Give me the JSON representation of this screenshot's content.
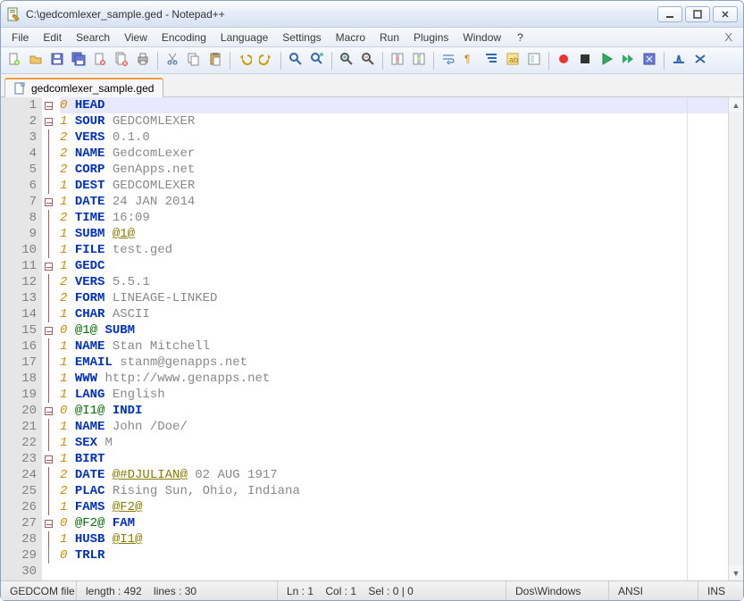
{
  "window": {
    "title": "C:\\gedcomlexer_sample.ged - Notepad++"
  },
  "menu": {
    "items": [
      "File",
      "Edit",
      "Search",
      "View",
      "Encoding",
      "Language",
      "Settings",
      "Macro",
      "Run",
      "Plugins",
      "Window",
      "?"
    ]
  },
  "toolbar": {
    "icons": [
      "new-file",
      "open-file",
      "save",
      "save-all",
      "close",
      "close-all",
      "print",
      "sep",
      "cut",
      "copy",
      "paste",
      "sep",
      "undo",
      "redo",
      "sep",
      "find",
      "replace",
      "sep",
      "zoom-in",
      "zoom-out",
      "sep",
      "sync-v",
      "sync-h",
      "sep",
      "wrap",
      "all-chars",
      "indent-guide",
      "lang",
      "doc-map",
      "sep",
      "record",
      "stop",
      "play",
      "play-multi",
      "save-macro",
      "sep",
      "toggle-1",
      "toggle-2"
    ]
  },
  "tab": {
    "label": "gedcomlexer_sample.ged"
  },
  "code": {
    "lines": [
      {
        "n": 1,
        "fold": "box",
        "lvl": "0",
        "tag": "HEAD",
        "val": "",
        "current": true
      },
      {
        "n": 2,
        "fold": "box",
        "lvl": "1",
        "tag": "SOUR",
        "val": "GEDCOMLEXER"
      },
      {
        "n": 3,
        "fold": "line",
        "lvl": "2",
        "tag": "VERS",
        "val": "0.1.0"
      },
      {
        "n": 4,
        "fold": "line",
        "lvl": "2",
        "tag": "NAME",
        "val": "GedcomLexer"
      },
      {
        "n": 5,
        "fold": "line",
        "lvl": "2",
        "tag": "CORP",
        "val": "GenApps.net"
      },
      {
        "n": 6,
        "fold": "line",
        "lvl": "1",
        "tag": "DEST",
        "val": "GEDCOMLEXER"
      },
      {
        "n": 7,
        "fold": "box",
        "lvl": "1",
        "tag": "DATE",
        "val": "24 JAN 2014"
      },
      {
        "n": 8,
        "fold": "line",
        "lvl": "2",
        "tag": "TIME",
        "val": "16:09"
      },
      {
        "n": 9,
        "fold": "line",
        "lvl": "1",
        "tag": "SUBM",
        "ref": "@1@"
      },
      {
        "n": 10,
        "fold": "line",
        "lvl": "1",
        "tag": "FILE",
        "val": "test.ged"
      },
      {
        "n": 11,
        "fold": "box",
        "lvl": "1",
        "tag": "GEDC",
        "val": ""
      },
      {
        "n": 12,
        "fold": "line",
        "lvl": "2",
        "tag": "VERS",
        "val": "5.5.1"
      },
      {
        "n": 13,
        "fold": "line",
        "lvl": "2",
        "tag": "FORM",
        "val": "LINEAGE-LINKED"
      },
      {
        "n": 14,
        "fold": "line",
        "lvl": "1",
        "tag": "CHAR",
        "val": "ASCII"
      },
      {
        "n": 15,
        "fold": "box",
        "lvl": "0",
        "id": "@1@",
        "tag": "SUBM",
        "val": ""
      },
      {
        "n": 16,
        "fold": "line",
        "lvl": "1",
        "tag": "NAME",
        "val": "Stan Mitchell"
      },
      {
        "n": 17,
        "fold": "line",
        "lvl": "1",
        "tag": "EMAIL",
        "val": "stanm@genapps.net"
      },
      {
        "n": 18,
        "fold": "line",
        "lvl": "1",
        "tag": "WWW",
        "val": "http://www.genapps.net"
      },
      {
        "n": 19,
        "fold": "line",
        "lvl": "1",
        "tag": "LANG",
        "val": "English"
      },
      {
        "n": 20,
        "fold": "box",
        "lvl": "0",
        "id": "@I1@",
        "tag": "INDI",
        "val": ""
      },
      {
        "n": 21,
        "fold": "line",
        "lvl": "1",
        "tag": "NAME",
        "val": "John /Doe/"
      },
      {
        "n": 22,
        "fold": "line",
        "lvl": "1",
        "tag": "SEX",
        "val": "M"
      },
      {
        "n": 23,
        "fold": "box",
        "lvl": "1",
        "tag": "BIRT",
        "val": ""
      },
      {
        "n": 24,
        "fold": "line",
        "lvl": "2",
        "tag": "DATE",
        "ref": "@#DJULIAN@",
        "val": "02 AUG 1917"
      },
      {
        "n": 25,
        "fold": "line",
        "lvl": "2",
        "tag": "PLAC",
        "val": "Rising Sun, Ohio, Indiana"
      },
      {
        "n": 26,
        "fold": "line",
        "lvl": "1",
        "tag": "FAMS",
        "ref": "@F2@"
      },
      {
        "n": 27,
        "fold": "box",
        "lvl": "0",
        "id": "@F2@",
        "tag": "FAM",
        "val": ""
      },
      {
        "n": 28,
        "fold": "line",
        "lvl": "1",
        "tag": "HUSB",
        "ref": "@I1@"
      },
      {
        "n": 29,
        "fold": "line2",
        "lvl": "0",
        "tag": "TRLR",
        "val": ""
      },
      {
        "n": 30,
        "fold": "none",
        "lvl": "",
        "tag": "",
        "val": ""
      }
    ]
  },
  "status": {
    "lang": "GEDCOM file",
    "length": "length : 492    lines : 30",
    "pos": "Ln : 1    Col : 1    Sel : 0 | 0",
    "eol": "Dos\\Windows",
    "enc": "ANSI",
    "ins": "INS"
  }
}
